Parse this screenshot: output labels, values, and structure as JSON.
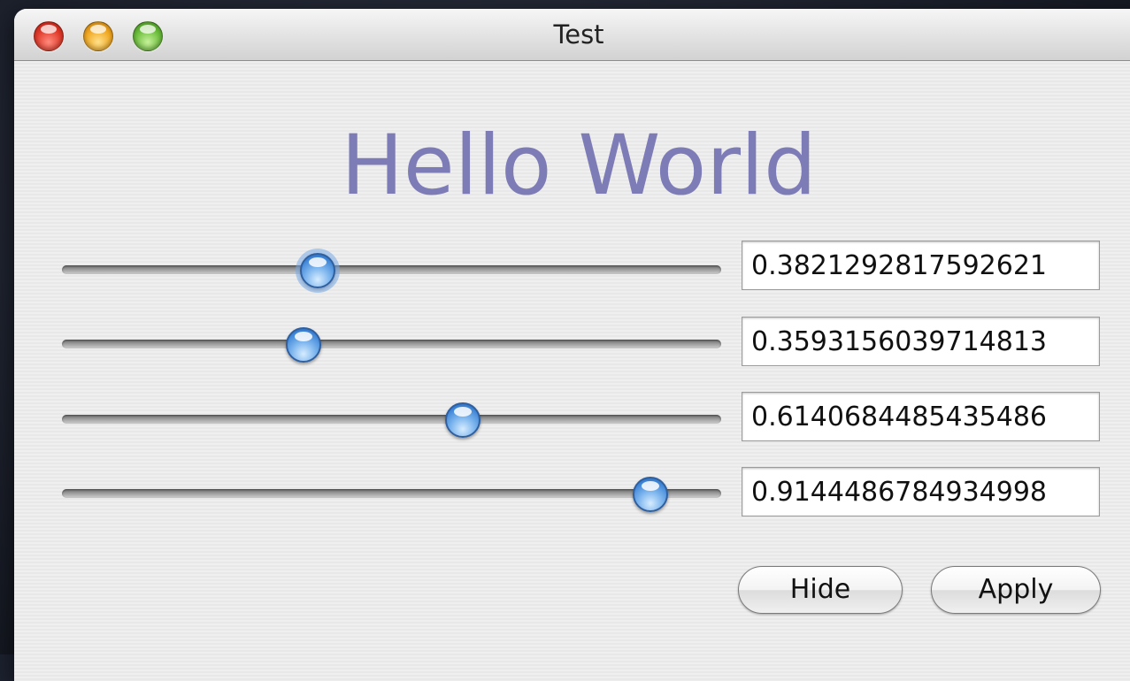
{
  "window": {
    "title": "Test"
  },
  "main": {
    "heading": "Hello World",
    "heading_color": "#7e7cb6",
    "sliders": [
      {
        "value": 0.3821292817592621,
        "text": "0.3821292817592621",
        "focused": true
      },
      {
        "value": 0.3593156039714813,
        "text": "0.3593156039714813",
        "focused": false
      },
      {
        "value": 0.6140684485435486,
        "text": "0.6140684485435486",
        "focused": false
      },
      {
        "value": 0.9144486784934998,
        "text": "0.9144486784934998",
        "focused": false
      }
    ]
  },
  "buttons": {
    "hide_label": "Hide",
    "apply_label": "Apply"
  }
}
